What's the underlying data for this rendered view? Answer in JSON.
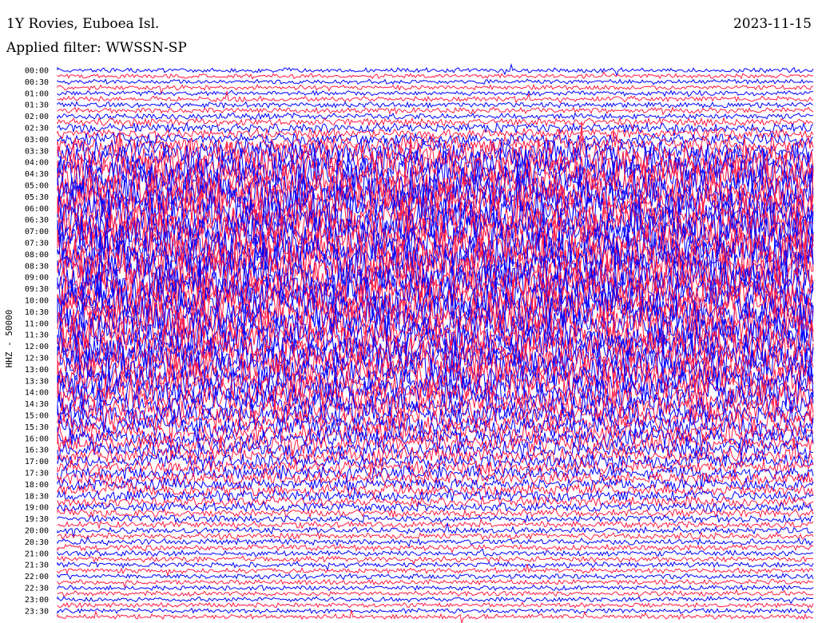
{
  "header": {
    "station": "1Y Rovies, Euboea Isl.",
    "filter": "Applied filter: WWSSN-SP",
    "date": "2023-11-15"
  },
  "chart_data": {
    "type": "line",
    "title": "1Y Rovies, Euboea Isl.",
    "subtitle": "Applied filter: WWSSN-SP",
    "ylabel": "HHZ - 50000",
    "date": "2023-11-15",
    "row_interval_minutes": 15,
    "tick_labels": [
      "00:00",
      "00:30",
      "01:00",
      "01:30",
      "02:00",
      "02:30",
      "03:00",
      "03:30",
      "04:00",
      "04:30",
      "05:00",
      "05:30",
      "06:00",
      "06:30",
      "07:00",
      "07:30",
      "08:00",
      "08:30",
      "09:00",
      "09:30",
      "10:00",
      "10:30",
      "11:00",
      "11:30",
      "12:00",
      "12:30",
      "13:00",
      "13:30",
      "14:00",
      "14:30",
      "15:00",
      "15:30",
      "16:00",
      "16:30",
      "17:00",
      "17:30",
      "18:00",
      "18:30",
      "19:00",
      "19:30",
      "20:00",
      "20:30",
      "21:00",
      "21:30",
      "22:00",
      "22:30",
      "23:00",
      "23:30"
    ],
    "row_count": 96,
    "colors": [
      "#0000ff",
      "#ff1a44"
    ],
    "amplitude_profile": {
      "hours": [
        0,
        1,
        2,
        3,
        3.5,
        4,
        5,
        6,
        7,
        8,
        9,
        10,
        11,
        12,
        13,
        14,
        15,
        16,
        17,
        18,
        19,
        19.5,
        20,
        21,
        22,
        23,
        24
      ],
      "relative_amplitude": [
        0.05,
        0.06,
        0.1,
        0.25,
        0.6,
        0.85,
        0.95,
        1.0,
        1.0,
        1.0,
        1.0,
        1.0,
        0.95,
        0.9,
        0.85,
        0.75,
        0.6,
        0.45,
        0.35,
        0.28,
        0.18,
        0.12,
        0.1,
        0.08,
        0.07,
        0.06,
        0.05
      ]
    },
    "grid": false,
    "legend": false
  }
}
